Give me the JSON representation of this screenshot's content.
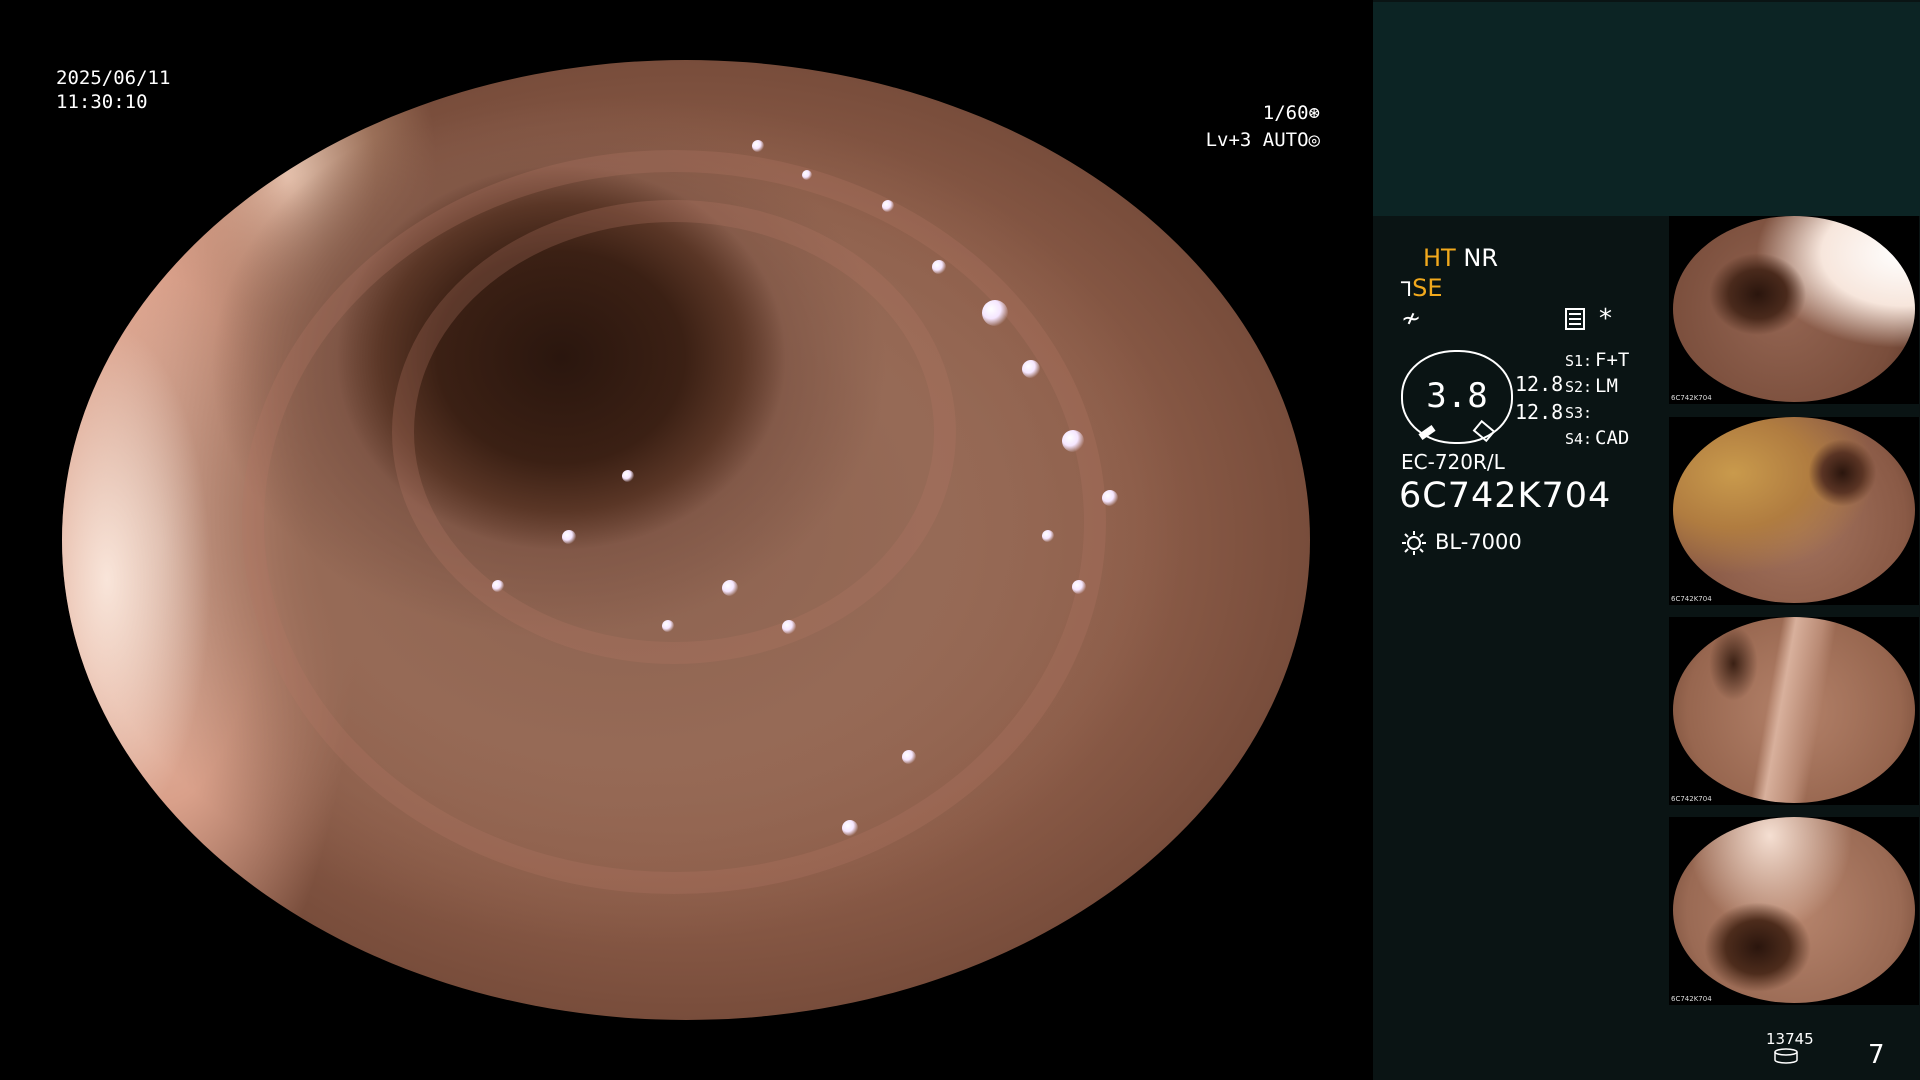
{
  "overlay": {
    "date": "2025/06/11",
    "time": "11:30:10",
    "shutter": "1/60",
    "level": "Lv+3 AUTO"
  },
  "panel": {
    "mode_ht": "HT",
    "mode_nr": "NR",
    "mode_se": "SE",
    "zoom_value": "3.8",
    "zoom_sub_1": "12.8",
    "zoom_sub_2": "12.8",
    "settings": [
      {
        "key": "S1:",
        "value": "F+T"
      },
      {
        "key": "S2:",
        "value": "LM"
      },
      {
        "key": "S3:",
        "value": ""
      },
      {
        "key": "S4:",
        "value": "CAD"
      }
    ],
    "scope_model": "EC-720R/L",
    "serial": "6C742K704",
    "light_source": "BL-7000",
    "counter": "13745",
    "page": "7"
  },
  "thumbnails": [
    {
      "caption": "6C742K704"
    },
    {
      "caption": "6C742K704"
    },
    {
      "caption": "6C742K704"
    },
    {
      "caption": "6C742K704"
    }
  ],
  "colors": {
    "panel_bg": "#0a1414",
    "panel_top": "#0c2424",
    "accent": "#f2a91d"
  }
}
